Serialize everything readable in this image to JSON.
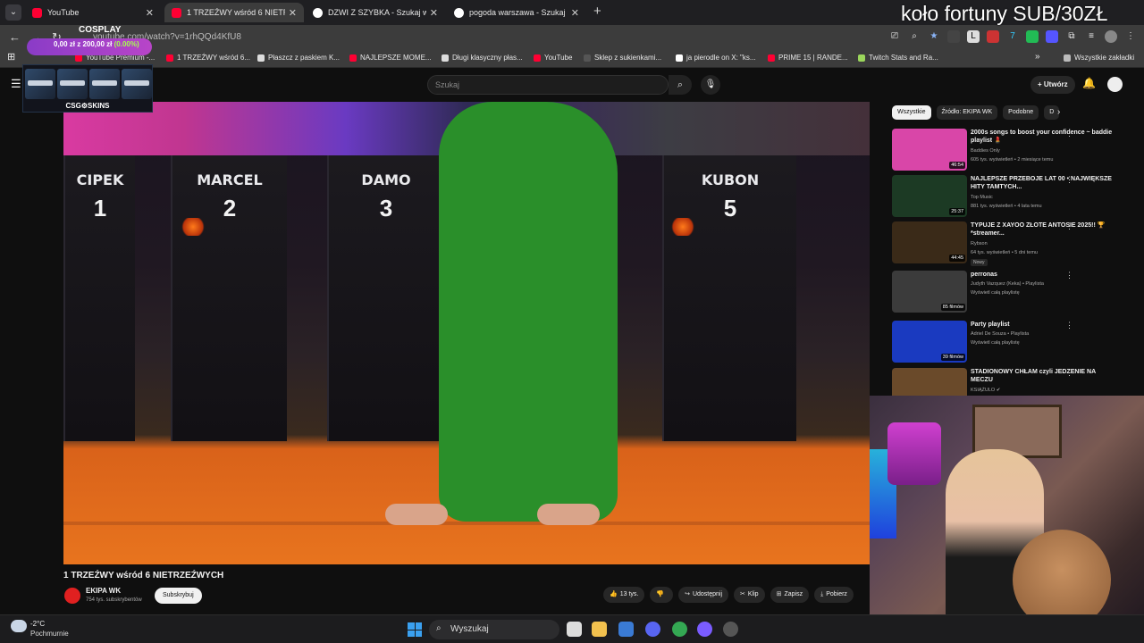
{
  "stream_overlay": {
    "wheel_text": "koło fortuny SUB/30ZŁ",
    "cosplay_label": "COSPLAY",
    "donation_amount": "0,00 zł z 200,00 zł",
    "donation_percent": "(0.00%)",
    "csgo_brand": "CSG⚙SKINS"
  },
  "browser": {
    "tabs": [
      {
        "label": "YouTube",
        "active": false
      },
      {
        "label": "1 TRZEŹWY wśród 6 NIETRZEŹW",
        "active": true
      },
      {
        "label": "DZWI Z SZYBKA - Szukaj w Goo",
        "active": false
      },
      {
        "label": "pogoda warszawa - Szukaj w Go",
        "active": false
      }
    ],
    "url": "youtube.com/watch?v=1rhQQd4KfU8",
    "bookmarks": [
      {
        "label": "YouTube Premium -...",
        "color": "#ff0033"
      },
      {
        "label": "1 TRZEŹWY wśród 6...",
        "color": "#ff0033"
      },
      {
        "label": "Płaszcz z paskiem K...",
        "color": "#dddddd"
      },
      {
        "label": "NAJLEPSZE MOME...",
        "color": "#ff0033"
      },
      {
        "label": "Długi klasyczny płas...",
        "color": "#dddddd"
      },
      {
        "label": "YouTube",
        "color": "#ff0033"
      },
      {
        "label": "Sklep z sukienkami...",
        "color": "#555555"
      },
      {
        "label": "ja pierodle on X: \"ks...",
        "color": "#ffffff"
      },
      {
        "label": "PRIME 15 | RANDE...",
        "color": "#ff0033"
      },
      {
        "label": "Twitch Stats and Ra...",
        "color": "#9bd65c"
      }
    ],
    "all_bookmarks": "Wszystkie zakładki"
  },
  "youtube": {
    "search_placeholder": "Szukaj",
    "create_label": "Utwórz",
    "video": {
      "board_names": [
        "CIPEK",
        "MARCEL",
        "DAMO",
        "KUBON"
      ],
      "board_numbers": [
        "1",
        "2",
        "3",
        "5"
      ]
    },
    "title": "1 TRZEŹWY wśród 6 NIETRZEŹWYCH",
    "channel": {
      "name": "EKIPA WK",
      "subs": "754 tys. subskrybentów"
    },
    "subscribe_label": "Subskrybuj",
    "actions": [
      {
        "icon": "like-icon",
        "label": "13 tys."
      },
      {
        "icon": "dislike-icon",
        "label": ""
      },
      {
        "icon": "share-icon",
        "label": "Udostępnij"
      },
      {
        "icon": "clip-icon",
        "label": "Klip"
      },
      {
        "icon": "save-icon",
        "label": "Zapisz"
      },
      {
        "icon": "download-icon",
        "label": "Pobierz"
      }
    ],
    "chips": [
      "Wszystkie",
      "Źródło: EKIPA WK",
      "Podobne",
      "D"
    ],
    "recommendations": [
      {
        "title": "2000s songs to boost your confidence ~ baddie playlist 💄",
        "meta1": "Baddies Only",
        "meta2": "605 tys. wyświetleń • 2 miesiące temu",
        "badge": "",
        "duration": "46:54",
        "thumb": "#d946a8"
      },
      {
        "title": "NAJLEPSZE PRZEBOJE LAT 00 • NAJWIĘKSZE HITY TAMTYCH...",
        "meta1": "Top Music",
        "meta2": "881 tys. wyświetleń • 4 lata temu",
        "badge": "",
        "duration": "25:37",
        "thumb": "#1c3a24"
      },
      {
        "title": "TYPUJE Z XAYOO ZŁOTE ANTOSIE 2025!! 🏆 *streamer...",
        "meta1": "Rybson",
        "meta2": "64 tys. wyświetleń • 5 dni temu",
        "badge": "Nowy",
        "duration": "44:45",
        "thumb": "#3a2a18"
      },
      {
        "title": "perronas",
        "meta1": "Judyth Vazquez (Keka) • Playlista",
        "meta2": "Wyświetl całą playlistę",
        "badge": "",
        "duration": "85 filmów",
        "thumb": "#3b3b3b"
      },
      {
        "title": "Party playlist",
        "meta1": "Adriel De Souza • Playlista",
        "meta2": "Wyświetl całą playlistę",
        "badge": "",
        "duration": "39 filmów",
        "thumb": "#1a3ac0"
      },
      {
        "title": "STADIONOWY CHŁAM czyli JEDZENIE NA MECZU",
        "meta1": "KSIĄŻULO ✔",
        "meta2": "",
        "badge": "",
        "duration": "",
        "thumb": "#6a4a2a"
      }
    ]
  },
  "taskbar": {
    "temp": "-2°C",
    "weather": "Pochmurnie",
    "search_label": "Wyszukaj"
  }
}
